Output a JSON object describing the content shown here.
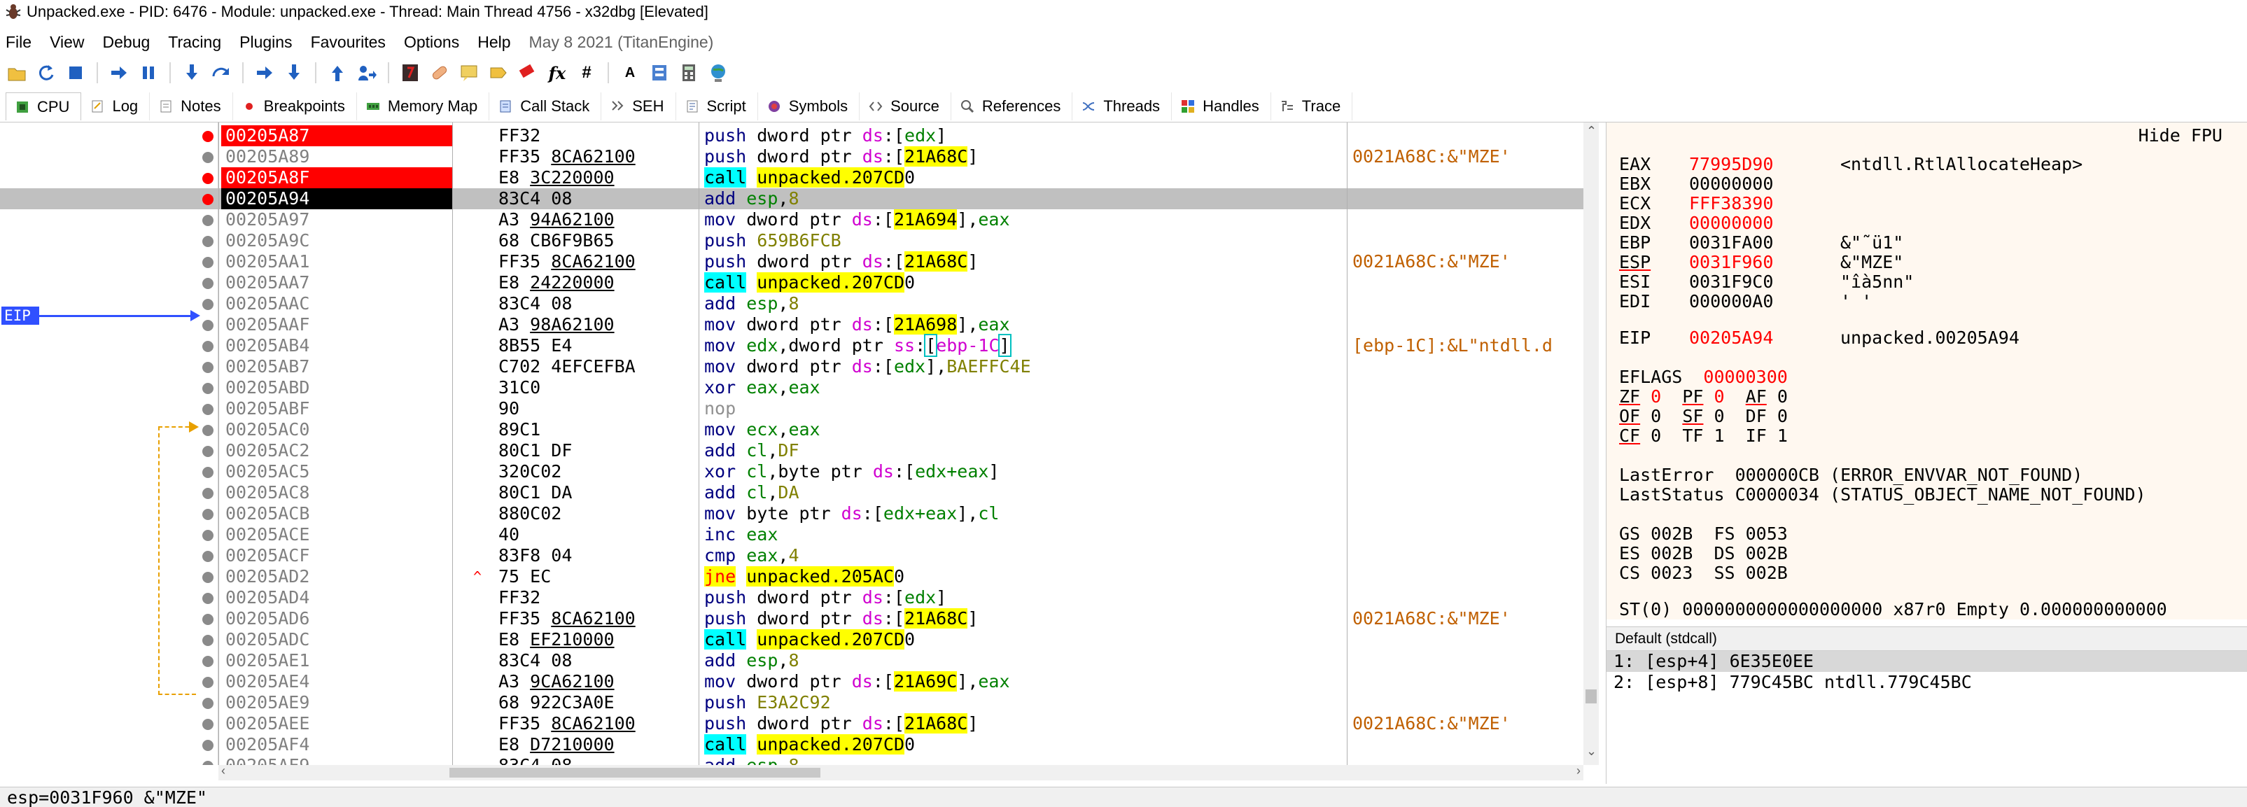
{
  "window": {
    "title": "Unpacked.exe - PID: 6476 - Module: unpacked.exe - Thread: Main Thread 4756 - x32dbg [Elevated]"
  },
  "menu": {
    "items": [
      "File",
      "View",
      "Debug",
      "Tracing",
      "Plugins",
      "Favourites",
      "Options",
      "Help"
    ],
    "date_label": "May 8 2021 (TitanEngine)"
  },
  "toolbar": {
    "buttons": [
      "open-icon",
      "restart-icon",
      "close-icon",
      "run-icon",
      "pause-icon",
      "step-into-icon",
      "step-over-icon",
      "trace-into-icon",
      "trace-over-icon",
      "execute-till-return-icon",
      "run-to-user-code-icon",
      "scylla-icon",
      "patch-icon",
      "comments-icon",
      "labels-icon",
      "bookmarks-icon",
      "functions-icon",
      "hash-icon",
      "font-icon",
      "settings-icon",
      "calculator-icon",
      "help-globe-icon"
    ],
    "fx_label": "fx",
    "hash_label": "#",
    "font_label": "A"
  },
  "tabs": [
    {
      "label": "CPU",
      "icon": "cpu-icon",
      "active": true
    },
    {
      "label": "Log",
      "icon": "log-icon"
    },
    {
      "label": "Notes",
      "icon": "notes-icon"
    },
    {
      "label": "Breakpoints",
      "icon": "breakpoint-icon"
    },
    {
      "label": "Memory Map",
      "icon": "memory-map-icon"
    },
    {
      "label": "Call Stack",
      "icon": "call-stack-icon"
    },
    {
      "label": "SEH",
      "icon": "seh-icon"
    },
    {
      "label": "Script",
      "icon": "script-icon"
    },
    {
      "label": "Symbols",
      "icon": "symbols-icon"
    },
    {
      "label": "Source",
      "icon": "source-icon"
    },
    {
      "label": "References",
      "icon": "references-icon"
    },
    {
      "label": "Threads",
      "icon": "threads-icon"
    },
    {
      "label": "Handles",
      "icon": "handles-icon"
    },
    {
      "label": "Trace",
      "icon": "trace-icon"
    }
  ],
  "eip_label": "EIP",
  "disasm": [
    {
      "addr": "00205A87",
      "bp": "red",
      "bytes": "FF32",
      "ins": [
        [
          "push",
          "mn"
        ],
        [
          " dword ptr ",
          ""
        ],
        [
          "ds",
          "ds"
        ],
        [
          ":[",
          ""
        ],
        [
          "edx",
          "reg"
        ],
        [
          "]",
          ""
        ]
      ],
      "cmt": ""
    },
    {
      "addr": "00205A89",
      "bp": "none",
      "bytes": "FF35 8CA62100",
      "ins": [
        [
          "push",
          "mn"
        ],
        [
          " dword ptr ",
          ""
        ],
        [
          "ds",
          "ds"
        ],
        [
          ":[",
          ""
        ],
        [
          "21A68C",
          "hl"
        ],
        [
          "]",
          ""
        ]
      ],
      "cmt": "0021A68C:&\"MZE'"
    },
    {
      "addr": "00205A8F",
      "bp": "redfill",
      "bytes": "E8 3C220000",
      "ins": [
        [
          "call",
          "call"
        ],
        [
          " ",
          ""
        ],
        [
          "unpacked.207CD",
          "hl"
        ],
        [
          "0",
          ""
        ]
      ],
      "cmt": ""
    },
    {
      "addr": "00205A94",
      "bp": "cur",
      "bytes": "83C4 08",
      "ins": [
        [
          "add",
          "mn"
        ],
        [
          " ",
          ""
        ],
        [
          "esp",
          "reg"
        ],
        [
          ",",
          ""
        ],
        [
          "8",
          "imm"
        ]
      ],
      "cmt": ""
    },
    {
      "addr": "00205A97",
      "bp": "",
      "bytes": "A3 94A62100",
      "ins": [
        [
          "mov",
          "mn"
        ],
        [
          " dword ptr ",
          ""
        ],
        [
          "ds",
          "ds"
        ],
        [
          ":[",
          ""
        ],
        [
          "21A694",
          "hl"
        ],
        [
          "],",
          ""
        ],
        [
          "eax",
          "reg"
        ]
      ],
      "cmt": ""
    },
    {
      "addr": "00205A9C",
      "bp": "",
      "bytes": "68 CB6F9B65",
      "ins": [
        [
          "push",
          "mn"
        ],
        [
          " ",
          ""
        ],
        [
          "659B6FCB",
          "imm"
        ]
      ],
      "cmt": ""
    },
    {
      "addr": "00205AA1",
      "bp": "",
      "bytes": "FF35 8CA62100",
      "ins": [
        [
          "push",
          "mn"
        ],
        [
          " dword ptr ",
          ""
        ],
        [
          "ds",
          "ds"
        ],
        [
          ":[",
          ""
        ],
        [
          "21A68C",
          "hl"
        ],
        [
          "]",
          ""
        ]
      ],
      "cmt": "0021A68C:&\"MZE'"
    },
    {
      "addr": "00205AA7",
      "bp": "",
      "bytes": "E8 24220000",
      "ins": [
        [
          "call",
          "call"
        ],
        [
          " ",
          ""
        ],
        [
          "unpacked.207CD",
          "hl"
        ],
        [
          "0",
          ""
        ]
      ],
      "cmt": ""
    },
    {
      "addr": "00205AAC",
      "bp": "",
      "bytes": "83C4 08",
      "ins": [
        [
          "add",
          "mn"
        ],
        [
          " ",
          ""
        ],
        [
          "esp",
          "reg"
        ],
        [
          ",",
          ""
        ],
        [
          "8",
          "imm"
        ]
      ],
      "cmt": ""
    },
    {
      "addr": "00205AAF",
      "bp": "",
      "bytes": "A3 98A62100",
      "ins": [
        [
          "mov",
          "mn"
        ],
        [
          " dword ptr ",
          ""
        ],
        [
          "ds",
          "ds"
        ],
        [
          ":[",
          ""
        ],
        [
          "21A698",
          "hl"
        ],
        [
          "],",
          ""
        ],
        [
          "eax",
          "reg"
        ]
      ],
      "cmt": ""
    },
    {
      "addr": "00205AB4",
      "bp": "",
      "bytes": "8B55 E4",
      "ins": [
        [
          "mov",
          "mn"
        ],
        [
          " ",
          ""
        ],
        [
          "edx",
          "reg"
        ],
        [
          ",dword ptr ",
          ""
        ],
        [
          "ss",
          "ds"
        ],
        [
          ":",
          ""
        ],
        [
          "[",
          "bx"
        ],
        [
          "ebp-1C",
          "ds"
        ],
        [
          "]",
          "bx"
        ]
      ],
      "cmt": "[ebp-1C]:&L\"ntdll.d"
    },
    {
      "addr": "00205AB7",
      "bp": "",
      "bytes": "C702 4EFCEFBA",
      "ins": [
        [
          "mov",
          "mn"
        ],
        [
          " dword ptr ",
          ""
        ],
        [
          "ds",
          "ds"
        ],
        [
          ":[",
          ""
        ],
        [
          "edx",
          "reg"
        ],
        [
          "],",
          ""
        ],
        [
          "BAEFFC4E",
          "imm"
        ]
      ],
      "cmt": ""
    },
    {
      "addr": "00205ABD",
      "bp": "",
      "bytes": "31C0",
      "ins": [
        [
          "xor",
          "mn"
        ],
        [
          " ",
          ""
        ],
        [
          "eax",
          "reg"
        ],
        [
          ",",
          ""
        ],
        [
          "eax",
          "reg"
        ]
      ],
      "cmt": ""
    },
    {
      "addr": "00205ABF",
      "bp": "",
      "bytes": "90",
      "ins": [
        [
          "nop",
          "grey"
        ]
      ],
      "cmt": ""
    },
    {
      "addr": "00205AC0",
      "bp": "",
      "bytes": "89C1",
      "ins": [
        [
          "mov",
          "mn"
        ],
        [
          " ",
          ""
        ],
        [
          "ecx",
          "reg"
        ],
        [
          ",",
          ""
        ],
        [
          "eax",
          "reg"
        ]
      ],
      "cmt": ""
    },
    {
      "addr": "00205AC2",
      "bp": "",
      "bytes": "80C1 DF",
      "ins": [
        [
          "add",
          "mn"
        ],
        [
          " ",
          ""
        ],
        [
          "cl",
          "reg"
        ],
        [
          ",",
          ""
        ],
        [
          "DF",
          "imm"
        ]
      ],
      "cmt": ""
    },
    {
      "addr": "00205AC5",
      "bp": "",
      "bytes": "320C02",
      "ins": [
        [
          "xor",
          "mn"
        ],
        [
          " ",
          ""
        ],
        [
          "cl",
          "reg"
        ],
        [
          ",byte ptr ",
          ""
        ],
        [
          "ds",
          "ds"
        ],
        [
          ":[",
          ""
        ],
        [
          "edx+eax",
          "reg"
        ],
        [
          "]",
          ""
        ]
      ],
      "cmt": ""
    },
    {
      "addr": "00205AC8",
      "bp": "",
      "bytes": "80C1 DA",
      "ins": [
        [
          "add",
          "mn"
        ],
        [
          " ",
          ""
        ],
        [
          "cl",
          "reg"
        ],
        [
          ",",
          ""
        ],
        [
          "DA",
          "imm"
        ]
      ],
      "cmt": ""
    },
    {
      "addr": "00205ACB",
      "bp": "",
      "bytes": "880C02",
      "ins": [
        [
          "mov",
          "mn"
        ],
        [
          " byte ptr ",
          ""
        ],
        [
          "ds",
          "ds"
        ],
        [
          ":[",
          ""
        ],
        [
          "edx+eax",
          "reg"
        ],
        [
          "],",
          ""
        ],
        [
          "cl",
          "reg"
        ]
      ],
      "cmt": ""
    },
    {
      "addr": "00205ACE",
      "bp": "",
      "bytes": "40",
      "ins": [
        [
          "inc",
          "mn"
        ],
        [
          " ",
          ""
        ],
        [
          "eax",
          "reg"
        ]
      ],
      "cmt": ""
    },
    {
      "addr": "00205ACF",
      "bp": "",
      "bytes": "83F8 04",
      "ins": [
        [
          "cmp",
          "mn"
        ],
        [
          " ",
          ""
        ],
        [
          "eax",
          "reg"
        ],
        [
          ",",
          ""
        ],
        [
          "4",
          "imm"
        ]
      ],
      "cmt": ""
    },
    {
      "addr": "00205AD2",
      "bp": "",
      "arrow": "^",
      "bytes": "75 EC",
      "ins": [
        [
          "jne",
          "jne"
        ],
        [
          " ",
          ""
        ],
        [
          "unpacked.205AC",
          "hl"
        ],
        [
          "0",
          ""
        ]
      ],
      "cmt": ""
    },
    {
      "addr": "00205AD4",
      "bp": "",
      "bytes": "FF32",
      "ins": [
        [
          "push",
          "mn"
        ],
        [
          " dword ptr ",
          ""
        ],
        [
          "ds",
          "ds"
        ],
        [
          ":[",
          ""
        ],
        [
          "edx",
          "reg"
        ],
        [
          "]",
          ""
        ]
      ],
      "cmt": ""
    },
    {
      "addr": "00205AD6",
      "bp": "",
      "bytes": "FF35 8CA62100",
      "ins": [
        [
          "push",
          "mn"
        ],
        [
          " dword ptr ",
          ""
        ],
        [
          "ds",
          "ds"
        ],
        [
          ":[",
          ""
        ],
        [
          "21A68C",
          "hl"
        ],
        [
          "]",
          ""
        ]
      ],
      "cmt": "0021A68C:&\"MZE'"
    },
    {
      "addr": "00205ADC",
      "bp": "",
      "bytes": "E8 EF210000",
      "ins": [
        [
          "call",
          "call"
        ],
        [
          " ",
          ""
        ],
        [
          "unpacked.207CD",
          "hl"
        ],
        [
          "0",
          ""
        ]
      ],
      "cmt": ""
    },
    {
      "addr": "00205AE1",
      "bp": "",
      "bytes": "83C4 08",
      "ins": [
        [
          "add",
          "mn"
        ],
        [
          " ",
          ""
        ],
        [
          "esp",
          "reg"
        ],
        [
          ",",
          ""
        ],
        [
          "8",
          "imm"
        ]
      ],
      "cmt": ""
    },
    {
      "addr": "00205AE4",
      "bp": "",
      "bytes": "A3 9CA62100",
      "ins": [
        [
          "mov",
          "mn"
        ],
        [
          " dword ptr ",
          ""
        ],
        [
          "ds",
          "ds"
        ],
        [
          ":[",
          ""
        ],
        [
          "21A69C",
          "hl"
        ],
        [
          "],",
          ""
        ],
        [
          "eax",
          "reg"
        ]
      ],
      "cmt": ""
    },
    {
      "addr": "00205AE9",
      "bp": "",
      "bytes": "68 922C3A0E",
      "ins": [
        [
          "push",
          "mn"
        ],
        [
          " ",
          ""
        ],
        [
          "E3A2C92",
          "imm"
        ]
      ],
      "cmt": ""
    },
    {
      "addr": "00205AEE",
      "bp": "",
      "bytes": "FF35 8CA62100",
      "ins": [
        [
          "push",
          "mn"
        ],
        [
          " dword ptr ",
          ""
        ],
        [
          "ds",
          "ds"
        ],
        [
          ":[",
          ""
        ],
        [
          "21A68C",
          "hl"
        ],
        [
          "]",
          ""
        ]
      ],
      "cmt": "0021A68C:&\"MZE'"
    },
    {
      "addr": "00205AF4",
      "bp": "",
      "bytes": "E8 D7210000",
      "ins": [
        [
          "call",
          "call"
        ],
        [
          " ",
          ""
        ],
        [
          "unpacked.207CD",
          "hl"
        ],
        [
          "0",
          ""
        ]
      ],
      "cmt": ""
    },
    {
      "addr": "00205AF9",
      "bp": "",
      "bytes": "83C4 08",
      "ins": [
        [
          "add",
          "mn"
        ],
        [
          " ",
          ""
        ],
        [
          "esp",
          "reg"
        ],
        [
          ",",
          ""
        ],
        [
          "8",
          "imm"
        ]
      ],
      "cmt": ""
    }
  ],
  "registers": {
    "hide_fpu": "Hide FPU",
    "gp": [
      {
        "name": "EAX",
        "value": "77995D90",
        "changed": true,
        "info": "<ntdll.RtlAllocateHeap>"
      },
      {
        "name": "EBX",
        "value": "00000000",
        "changed": false,
        "info": ""
      },
      {
        "name": "ECX",
        "value": "FFF38390",
        "changed": true,
        "info": ""
      },
      {
        "name": "EDX",
        "value": "00000000",
        "changed": true,
        "info": ""
      },
      {
        "name": "EBP",
        "value": "0031FA00",
        "changed": false,
        "info": "&\"˜ü1\""
      },
      {
        "name": "ESP",
        "value": "0031F960",
        "changed": true,
        "info": "&\"MZE\""
      },
      {
        "name": "ESI",
        "value": "0031F9C0",
        "changed": false,
        "info": "\"îà5nn\""
      },
      {
        "name": "EDI",
        "value": "000000A0",
        "changed": false,
        "info": "' '"
      }
    ],
    "eip": {
      "name": "EIP",
      "value": "00205A94",
      "info": "unpacked.00205A94"
    },
    "eflags": {
      "name": "EFLAGS",
      "value": "00000300"
    },
    "flags_rows": [
      [
        {
          "n": "ZF",
          "v": "0",
          "u": true,
          "r": true
        },
        {
          "n": "PF",
          "v": "0",
          "u": true,
          "r": true
        },
        {
          "n": "AF",
          "v": "0",
          "u": true,
          "r": false
        }
      ],
      [
        {
          "n": "OF",
          "v": "0",
          "u": true,
          "r": false
        },
        {
          "n": "SF",
          "v": "0",
          "u": true,
          "r": false
        },
        {
          "n": "DF",
          "v": "0",
          "u": false,
          "r": false
        }
      ],
      [
        {
          "n": "CF",
          "v": "0",
          "u": true,
          "r": false
        },
        {
          "n": "TF",
          "v": "1",
          "u": false,
          "r": false
        },
        {
          "n": "IF",
          "v": "1",
          "u": false,
          "r": false
        }
      ]
    ],
    "last_error": "LastError  000000CB (ERROR_ENVVAR_NOT_FOUND)",
    "last_status": "LastStatus C0000034 (STATUS_OBJECT_NAME_NOT_FOUND)",
    "segs": [
      "GS 002B  FS 0053",
      "ES 002B  DS 002B",
      "CS 0023  SS 002B"
    ],
    "st0": "ST(0) 0000000000000000000 x87r0 Empty 0.000000000000"
  },
  "stdcall": {
    "header": "Default (stdcall)",
    "rows": [
      "1: [esp+4] 6E35E0EE",
      "2: [esp+8] 779C45BC ntdll.779C45BC"
    ]
  },
  "status_line": "esp=0031F960 &\"MZE\""
}
